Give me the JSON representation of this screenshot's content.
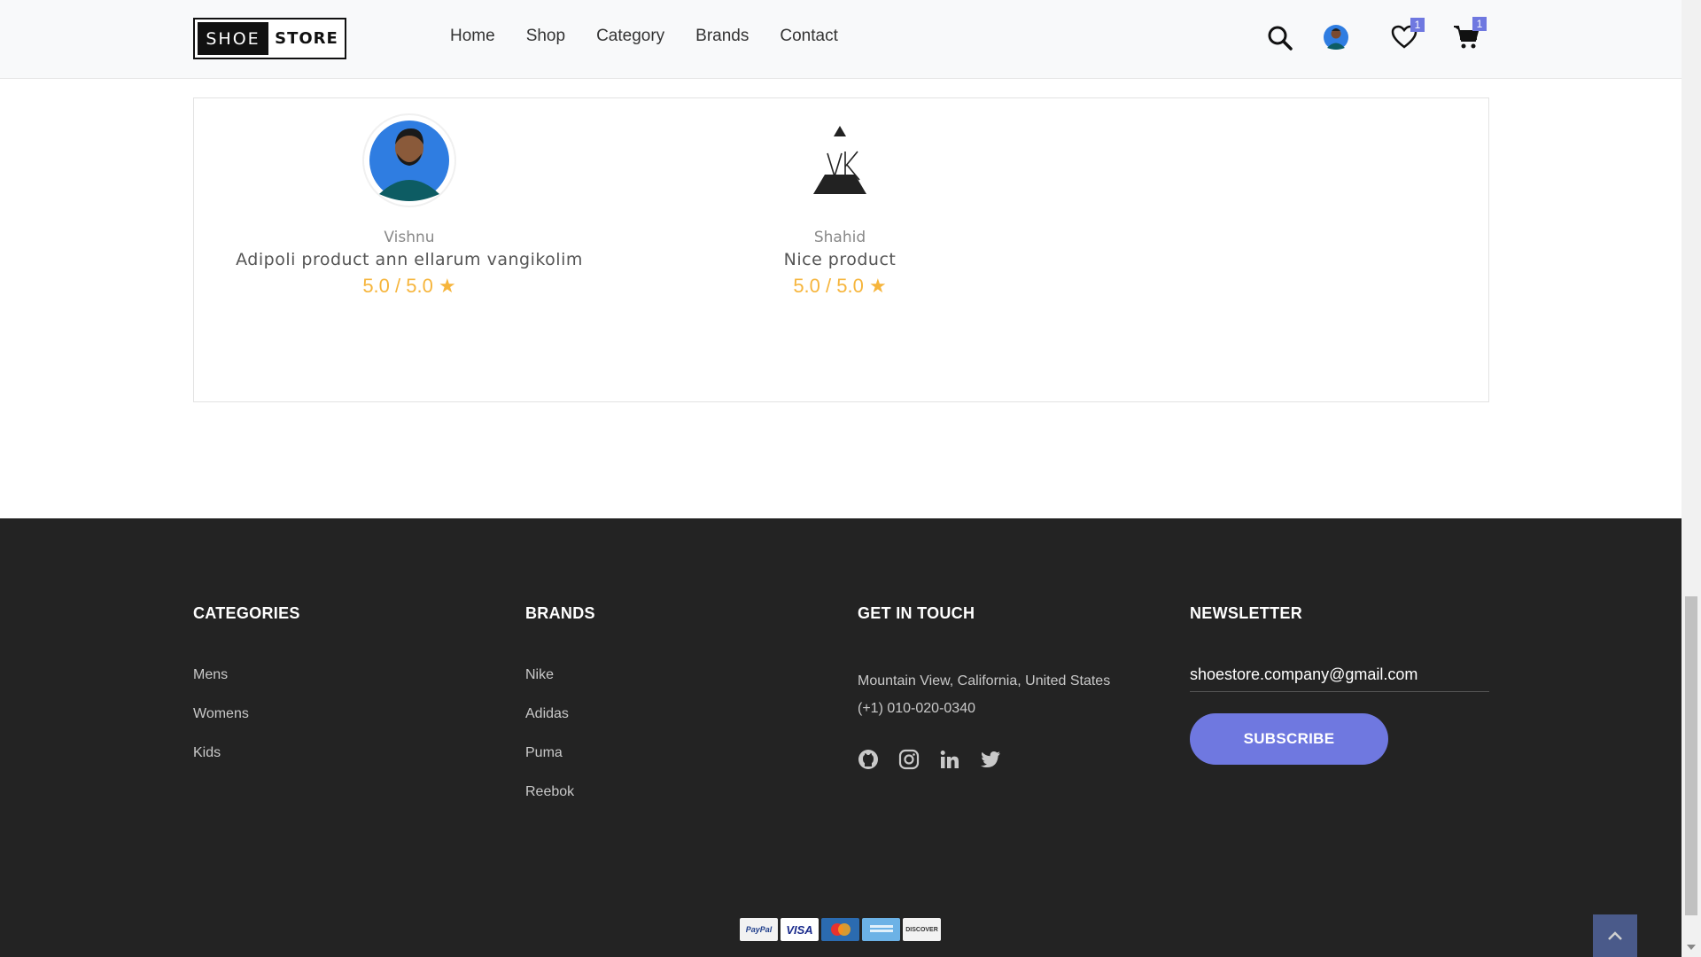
{
  "brand": {
    "part1": "SHOE",
    "part2": "STORE"
  },
  "nav": {
    "items": [
      {
        "label": "Home"
      },
      {
        "label": "Shop"
      },
      {
        "label": "Category"
      },
      {
        "label": "Brands"
      },
      {
        "label": "Contact"
      }
    ]
  },
  "header_icons": {
    "search": "search-icon",
    "profile": "avatar",
    "wishlist": "heart-icon",
    "wishlist_count": "1",
    "cart": "cart-icon",
    "cart_count": "1",
    "badge_color": "#6f78e0"
  },
  "reviews": [
    {
      "name": "Vishnu",
      "comment": "Adipoli product ann ellarum vangikolim",
      "rating": "5.0 / 5.0",
      "star": "★",
      "avatar": "person-avatar"
    },
    {
      "name": "Shahid",
      "comment": "Nice product",
      "rating": "5.0 / 5.0",
      "star": "★",
      "avatar": "vk-logo-avatar"
    }
  ],
  "footer": {
    "categories": {
      "title": "CATEGORIES",
      "items": [
        "Mens",
        "Womens",
        "Kids"
      ]
    },
    "brands": {
      "title": "BRANDS",
      "items": [
        "Nike",
        "Adidas",
        "Puma",
        "Reebok"
      ]
    },
    "contact": {
      "title": "GET IN TOUCH",
      "address": "Mountain View, California, United States",
      "phone": "(+1) 010-020-0340",
      "socials": [
        "github-icon",
        "instagram-icon",
        "linkedin-icon",
        "twitter-icon"
      ]
    },
    "newsletter": {
      "title": "NEWSLETTER",
      "email": "shoestore.company@gmail.com",
      "button": "SUBSCRIBE"
    },
    "payments": [
      "PayPal",
      "VISA",
      "MasterCard",
      "AmEx",
      "DISCOVER"
    ]
  },
  "colors": {
    "accent": "#6f78e0",
    "footer_bg": "#232323",
    "rating": "#f6b53c"
  }
}
